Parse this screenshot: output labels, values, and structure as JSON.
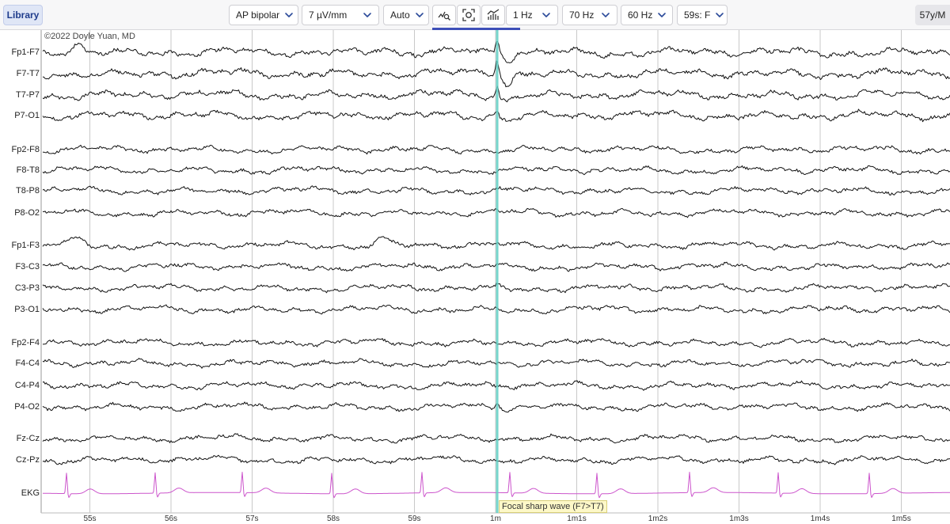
{
  "toolbar": {
    "library_label": "Library",
    "montage": "AP bipolar",
    "sensitivity": "7 µV/mm",
    "scale_mode": "Auto",
    "low_filter": "1 Hz",
    "high_filter": "70 Hz",
    "notch_filter": "60 Hz",
    "page_label": "59s: F",
    "patient_age": "57y/M",
    "icons": [
      "waveform-search-icon",
      "fit-screen-icon",
      "spectrum-icon"
    ]
  },
  "copyright": "©2022 Doyle Yuan, MD",
  "channels": [
    {
      "label": "Fp1-F7"
    },
    {
      "label": "F7-T7"
    },
    {
      "label": "T7-P7"
    },
    {
      "label": "P7-O1"
    },
    {
      "label": "Fp2-F8"
    },
    {
      "label": "F8-T8"
    },
    {
      "label": "T8-P8"
    },
    {
      "label": "P8-O2"
    },
    {
      "label": "Fp1-F3"
    },
    {
      "label": "F3-C3"
    },
    {
      "label": "C3-P3"
    },
    {
      "label": "P3-O1"
    },
    {
      "label": "Fp2-F4"
    },
    {
      "label": "F4-C4"
    },
    {
      "label": "C4-P4"
    },
    {
      "label": "P4-O2"
    },
    {
      "label": "Fz-Cz"
    },
    {
      "label": "Cz-Pz"
    },
    {
      "label": "EKG",
      "color": "#cc55cc"
    }
  ],
  "time_axis": {
    "labels": [
      "55s",
      "56s",
      "57s",
      "58s",
      "59s",
      "1m",
      "1m1s",
      "1m2s",
      "1m3s",
      "1m4s",
      "1m5s"
    ],
    "start_s": 54.4,
    "end_s": 65.6
  },
  "marker": {
    "time_s": 60.02,
    "color": "#5fd0c4",
    "annotation": "Focal sharp wave (F7>T7)"
  },
  "colors": {
    "accent": "#3e4fb8",
    "trace": "#111111",
    "ekg": "#cc55cc",
    "grid": "#c9c9c9"
  }
}
